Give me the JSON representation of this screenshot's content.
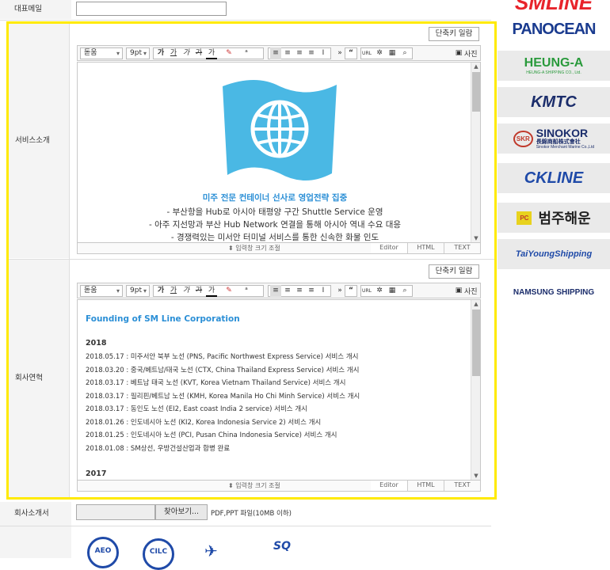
{
  "email_label": "대표메일",
  "service_label": "서비스소개",
  "history_label": "회사연혁",
  "brochure_label": "회사소개서",
  "shortcut_btn": "단축키 일람",
  "toolbar": {
    "font": "돋움",
    "size": "9pt",
    "bold": "가",
    "underline": "가",
    "italic": "가",
    "strike": "가",
    "color": "가",
    "more": "»",
    "quote": "“",
    "url": "URL",
    "photo": "사진"
  },
  "editor_footer": {
    "resize": "입력창 크기 조절",
    "tab_editor": "Editor",
    "tab_html": "HTML",
    "tab_text": "TEXT"
  },
  "service": {
    "headline": "미주 전문 컨테이너 선사로 영업전략 집중",
    "bullets": [
      "- 부산항을 Hub로 아시아 태평양 구간 Shuttle Service 운영",
      "- 아주 지선망과 부산 Hub Network 연결을 통해 아시아 역내 수요 대응",
      "- 경쟁력있는 미서안 터미널 서비스를 통한 신속한 화물 인도"
    ]
  },
  "history": {
    "title": "Founding of SM Line Corporation",
    "year1": "2018",
    "entries": [
      "2018.05.17 : 미주서안 북부 노선 (PNS, Pacific Northwest Express Service) 서비스 개시",
      "2018.03.20 : 중국/베트남/태국 노선 (CTX, China Thailand Express Service) 서비스 개시",
      "2018.03.17 : 베트남 태국 노선 (KVT, Korea Vietnam Thailand Service) 서비스 개시",
      "2018.03.17 : 필리핀/베트남 노선 (KMH, Korea Manila Ho Chi Minh Service) 서비스 개시",
      "2018.03.17 : 동인도 노선 (EI2, East coast India 2 service) 서비스 개시",
      "2018.01.26 : 인도네시아 노선 (KI2, Korea Indonesia Service 2) 서비스 개시",
      "2018.01.25 : 인도네시아 노선 (PCI, Pusan China Indonesia Service) 서비스 개시",
      "2018.01.08 : SM상선, 우방건설산업과 합병 완료"
    ],
    "year2": "2017"
  },
  "file": {
    "browse": "찾아보기...",
    "hint": "PDF,PPT 파일(10MB 이하)"
  },
  "logos": [
    "SMLINE",
    "PANOCEAN",
    "HEUNG-A",
    "HEUNG-A SHIPPING CO., Ltd.",
    "KMTC",
    "SKR",
    "SINOKOR",
    "長錦商船株式會社",
    "Sinokor Merchant Marine Co.,Ltd",
    "CKLINE",
    "범주해운",
    "PC",
    "TaiYoungShipping",
    "NAMSUNG SHIPPING"
  ],
  "certs": [
    "AEO",
    "CILC",
    "SQ"
  ],
  "colors": {
    "highlight": "#ffea00",
    "link_blue": "#2b8fd6",
    "panocean": "#1a3b8f",
    "heunga": "#2a9a3c",
    "kmtc": "#1b2d6b",
    "sinokor": "#c0392b",
    "ckline": "#1f4aa8"
  }
}
